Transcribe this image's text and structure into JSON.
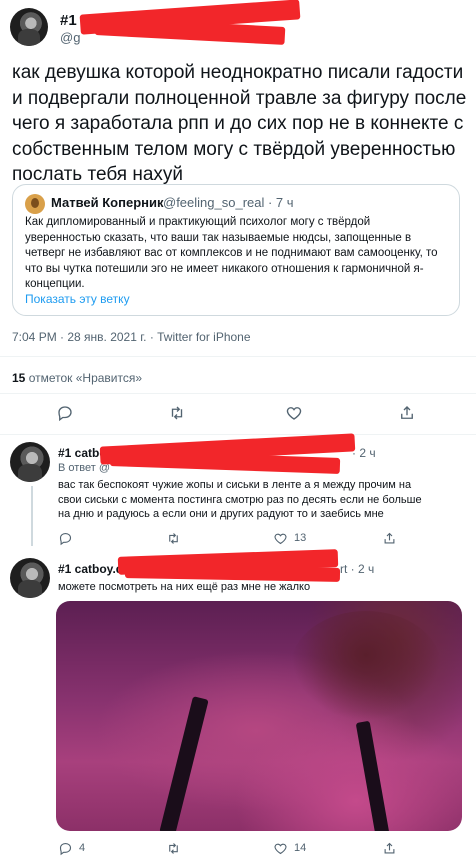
{
  "main_tweet": {
    "display_name": "#1",
    "handle": "@g",
    "text": "как девушка которой неоднократно писали гадости\nи подвергали полноценной травле за фигуру после\nчего я заработала рпп и до сих пор не в коннекте с\nсобственным телом могу с твёрдой уверенностью\nпослать тебя нахуй",
    "quote": {
      "name": "Матвей Коперник",
      "handle": "@feeling_so_real · 7 ч",
      "text": "Как дипломированный и практикующий психолог могу с твёрдой\nуверенностью сказать, что ваши так называемые нюдсы, запощенные в\nчетверг не избавляют вас от комплексов и не поднимают вам самооценку, то\nчто вы чутка потешили эго не имеет никакого отношения к гармоничной я-\nконцепции.",
      "show_thread": "Показать эту ветку"
    },
    "meta": "7:04 PM · 28 янв. 2021 г. · Twitter for iPhone",
    "likes_count": "15",
    "likes_label": " отметок «Нравится»"
  },
  "reply1": {
    "name": "#1 catbo",
    "time": "· 2 ч",
    "in_reply_to": "В ответ @",
    "text": "вас так беспокоят чужие жопы и сиськи в ленте а я между прочим на\nсвои сиськи с момента постинга смотрю раз по десять если не больше\nна дню и радуюсь а если они и других радуют то и заебись мне",
    "reply_count": "",
    "retweet_count": "",
    "like_count": "13"
  },
  "reply2": {
    "name": "#1 catboy.de",
    "time": "rt · 2 ч",
    "text": "можете посмотреть на них ещё раз мне не жалко",
    "reply_count": "4",
    "retweet_count": "",
    "like_count": "14"
  },
  "icons": [
    "reply-icon",
    "retweet-icon",
    "like-icon",
    "share-icon"
  ],
  "colors": {
    "redaction": "#f2262a",
    "link": "#1d9bf0",
    "muted": "#536471"
  }
}
